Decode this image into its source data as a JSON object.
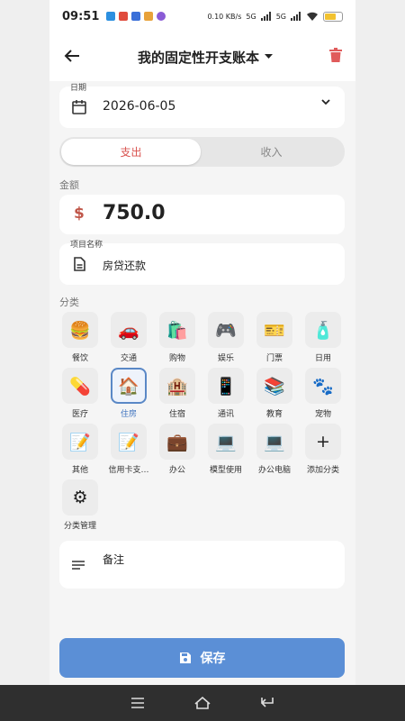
{
  "status": {
    "time": "09:51",
    "net_speed": "0.10 KB/s",
    "signal1": "5G",
    "signal2": "5G"
  },
  "appbar": {
    "title": "我的固定性开支账本"
  },
  "date": {
    "label": "日期",
    "value": "2026-06-05"
  },
  "type_tabs": {
    "expense": "支出",
    "income": "收入"
  },
  "amount": {
    "label": "金额",
    "value": "750.0"
  },
  "item": {
    "label": "项目名称",
    "value": "房贷还款"
  },
  "category": {
    "label": "分类",
    "items": [
      {
        "name": "餐饮",
        "icon": "🍔"
      },
      {
        "name": "交通",
        "icon": "🚗"
      },
      {
        "name": "购物",
        "icon": "🛍️"
      },
      {
        "name": "娱乐",
        "icon": "🎮"
      },
      {
        "name": "门票",
        "icon": "🎫"
      },
      {
        "name": "日用",
        "icon": "🧴"
      },
      {
        "name": "医疗",
        "icon": "💊"
      },
      {
        "name": "住房",
        "icon": "🏠"
      },
      {
        "name": "住宿",
        "icon": "🏨"
      },
      {
        "name": "通讯",
        "icon": "📱"
      },
      {
        "name": "教育",
        "icon": "📚"
      },
      {
        "name": "宠物",
        "icon": "🐾"
      },
      {
        "name": "其他",
        "icon": "📝"
      },
      {
        "name": "信用卡支…",
        "icon": "📝"
      },
      {
        "name": "办公",
        "icon": "💼"
      },
      {
        "name": "模型使用",
        "icon": "💻"
      },
      {
        "name": "办公电脑",
        "icon": "💻"
      },
      {
        "name": "添加分类",
        "icon": "+"
      },
      {
        "name": "分类管理",
        "icon": "⚙"
      }
    ],
    "selected": "住房"
  },
  "note": {
    "placeholder": "备注"
  },
  "save_label": "保存",
  "colors": {
    "accent": "#5b8fd6",
    "expense": "#d9534f",
    "delete": "#e05b5b"
  }
}
